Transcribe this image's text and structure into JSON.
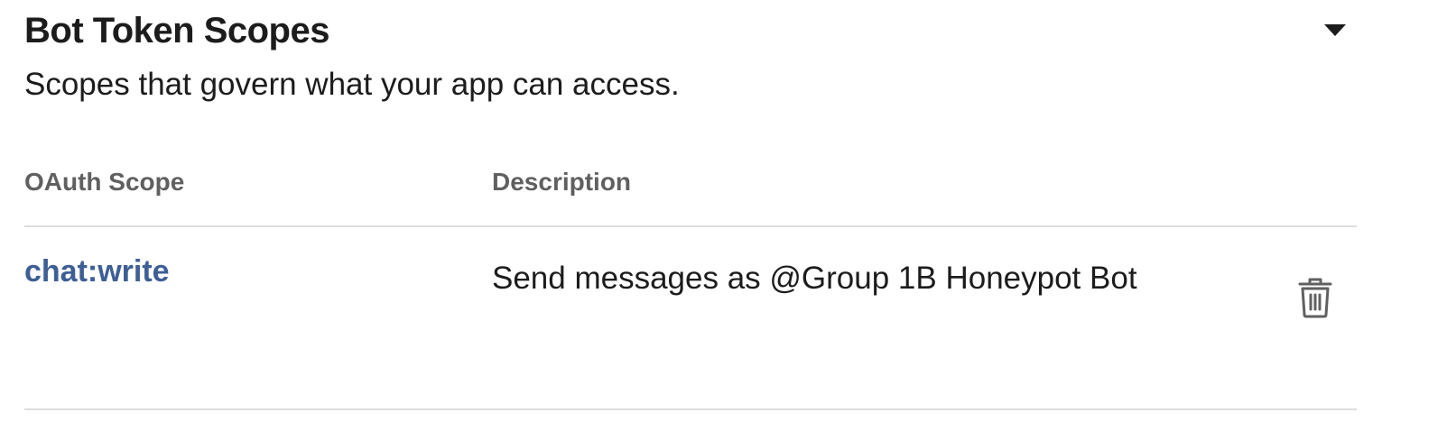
{
  "section": {
    "title": "Bot Token Scopes",
    "subtitle": "Scopes that govern what your app can access."
  },
  "table": {
    "headers": {
      "scope": "OAuth Scope",
      "description": "Description"
    },
    "rows": [
      {
        "scope": "chat:write",
        "description": "Send messages as @Group 1B Honeypot Bot",
        "action_icon": "trash-icon"
      }
    ]
  },
  "colors": {
    "text": "#1d1c1d",
    "header_text": "#616061",
    "scope_link": "#3e5f96",
    "divider": "#dddddd",
    "icon": "#616061"
  }
}
